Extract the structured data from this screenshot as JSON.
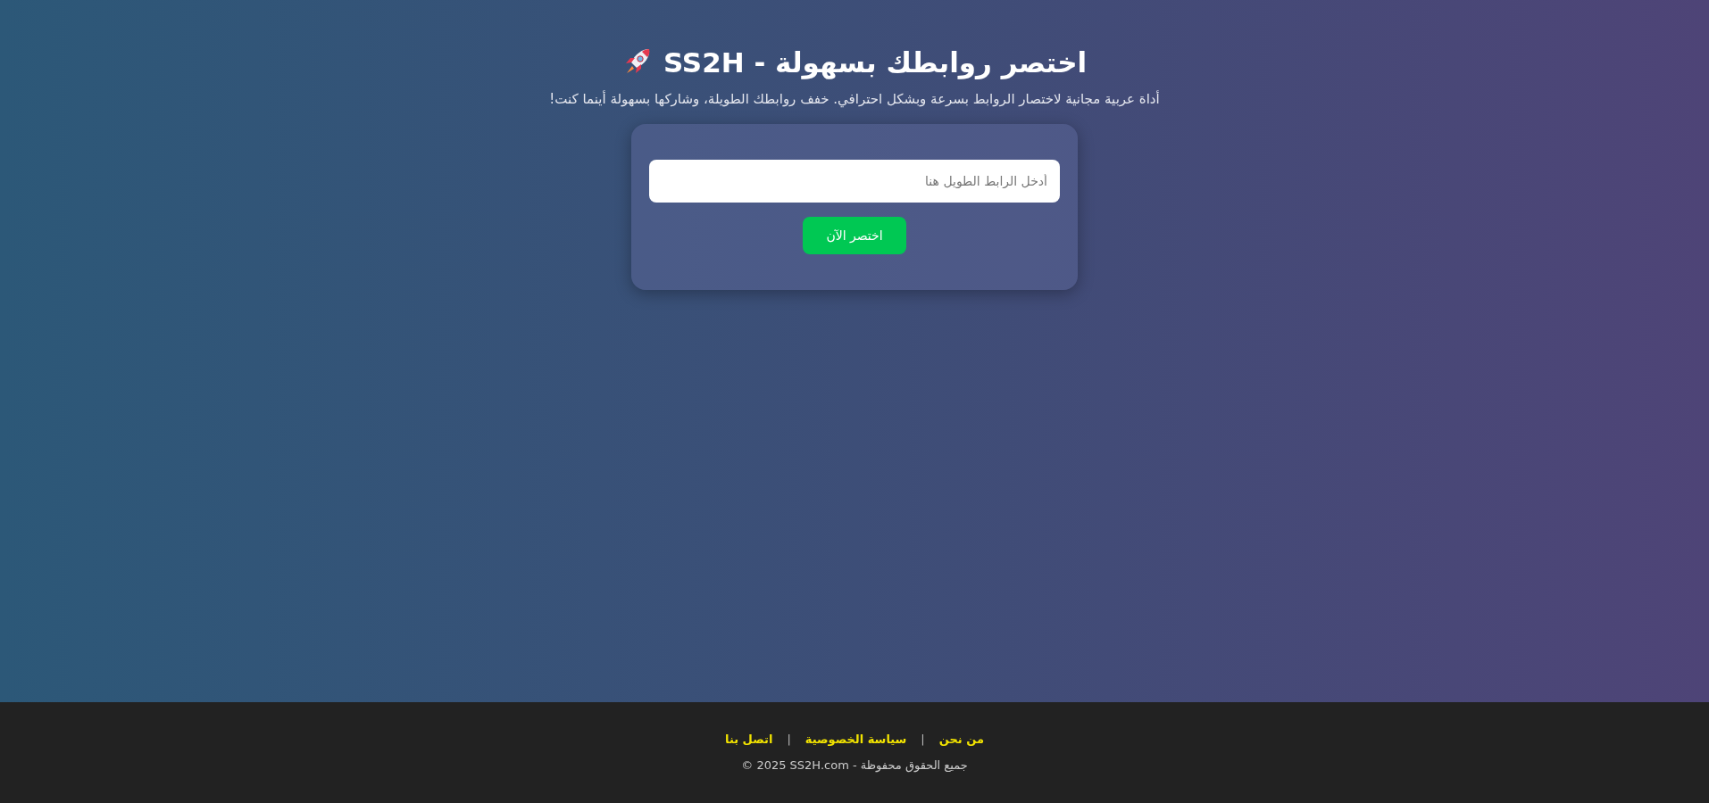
{
  "header": {
    "title": "اختصر روابطك بسهولة - SS2H",
    "subtitle": "أداة عربية مجانية لاختصار الروابط بسرعة وبشكل احترافي. خفف روابطك الطويلة، وشاركها بسهولة أينما كنت!"
  },
  "form": {
    "placeholder": "أدخل الرابط الطويل هنا",
    "button": "اختصر الآن"
  },
  "footer": {
    "items": [
      {
        "kind": "link",
        "label": "من نحن"
      },
      {
        "kind": "separator",
        "label": "|"
      },
      {
        "kind": "link",
        "label": "سياسة الخصوصية"
      },
      {
        "kind": "separator",
        "label": "|"
      },
      {
        "kind": "link",
        "label": "اتصل بنا"
      }
    ],
    "copyright": "© 2025 SS2H.com - جميع الحقوق محفوظة"
  }
}
